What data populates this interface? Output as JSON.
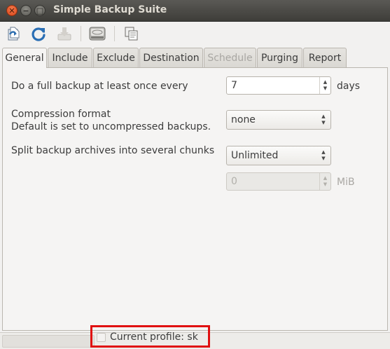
{
  "window": {
    "title": "Simple Backup Suite",
    "close_glyph": "✕",
    "minimize_glyph": "−",
    "maximize_glyph": "□"
  },
  "toolbar": {
    "buttons": [
      {
        "icon": "new-profile-icon",
        "enabled": true
      },
      {
        "icon": "refresh-icon",
        "enabled": true
      },
      {
        "icon": "save-icon",
        "enabled": false
      },
      {
        "icon": "backup-drive-icon",
        "enabled": true
      },
      {
        "icon": "copy-icon",
        "enabled": true
      }
    ]
  },
  "tabs": [
    {
      "label": "General",
      "active": true
    },
    {
      "label": "Include"
    },
    {
      "label": "Exclude"
    },
    {
      "label": "Destination"
    },
    {
      "label": "Schedule",
      "disabled": true
    },
    {
      "label": "Purging"
    },
    {
      "label": "Report"
    }
  ],
  "general": {
    "full_backup_label": "Do a full backup at least once every",
    "full_backup_value": "7",
    "full_backup_unit": "days",
    "compression_label": "Compression format",
    "compression_hint": "Default is set to uncompressed backups.",
    "compression_value": "none",
    "split_label": "Split backup archives into several chunks",
    "split_value": "Unlimited",
    "chunk_size_value": "0",
    "chunk_size_unit": "MiB"
  },
  "statusbar": {
    "profile_text": "Current profile: sk"
  },
  "colors": {
    "titlebar": "#3e3d39",
    "highlight_box": "#e01010",
    "close_button": "#d9461c"
  }
}
